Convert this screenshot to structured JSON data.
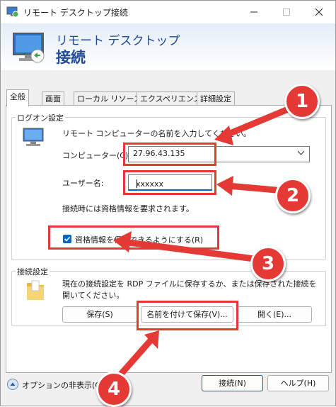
{
  "window": {
    "title": "リモート デスクトップ接続"
  },
  "header": {
    "line1": "リモート デスクトップ",
    "line2": "接続"
  },
  "tabs": [
    "全般",
    "画面",
    "ローカル リソース",
    "エクスペリエンス",
    "詳細設定"
  ],
  "logon": {
    "group_label": "ログオン設定",
    "instruction": "リモート コンピューターの名前を入力してください。",
    "computer_label": "コンピューター(C):",
    "computer_value": "27.96.43.135",
    "user_label": "ユーザー名:",
    "user_value": "xxxxxx",
    "credentials_note": "接続時には資格情報を要求されます。",
    "save_credentials_label": "資格情報を保存できるようにする(R)",
    "save_credentials_checked": true
  },
  "conn": {
    "group_label": "接続設定",
    "description_line1": "現在の接続設定を RDP ファイルに保存するか、または保存された接続を",
    "description_line2": "開いてください。",
    "save_label": "保存(S)",
    "save_as_label": "名前を付けて保存(V)...",
    "open_label": "開く(E)..."
  },
  "footer": {
    "options_label": "オプションの非表示(O)",
    "connect_label": "接続(N)",
    "help_label": "ヘルプ(H)"
  },
  "annotations": [
    "1",
    "2",
    "3",
    "4"
  ],
  "colors": {
    "accent": "#0067c0",
    "annotation": "#e53935",
    "header_text": "#1f4a9a"
  }
}
